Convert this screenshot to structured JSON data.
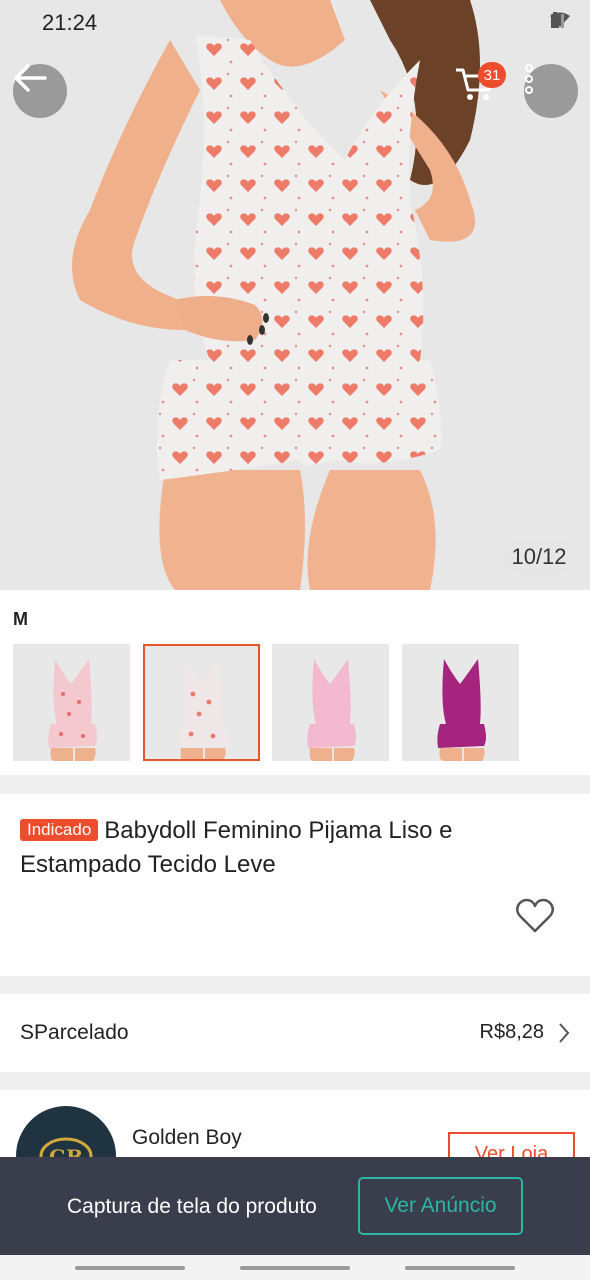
{
  "status_bar": {
    "time": "21:24"
  },
  "product_images": {
    "counter": "10/12",
    "cart_count": "31"
  },
  "variation": {
    "selected_label": "M",
    "thumbnails": [
      {
        "color": "#f3c9cf",
        "dot": "#e86a6a"
      },
      {
        "color": "#efe7e7",
        "dot": "#ec7a6a"
      },
      {
        "color": "#f3b9cf",
        "dot": "#f0a3bb"
      },
      {
        "color": "#a4247e",
        "dot": "#7a1a5e"
      }
    ]
  },
  "product": {
    "badge": "Indicado",
    "title": "Babydoll Feminino Pijama Liso e Estampado Tecido Leve"
  },
  "installment": {
    "label": "SParcelado",
    "value": "R$8,28"
  },
  "shop": {
    "name": "Golden Boy",
    "button": "Ver Loja",
    "avatar_text": "GB"
  },
  "snackbar": {
    "text": "Captura de tela do produto",
    "button": "Ver Anúncio"
  },
  "colors": {
    "accent": "#ee4d2d",
    "teal": "#2bb5a4"
  }
}
